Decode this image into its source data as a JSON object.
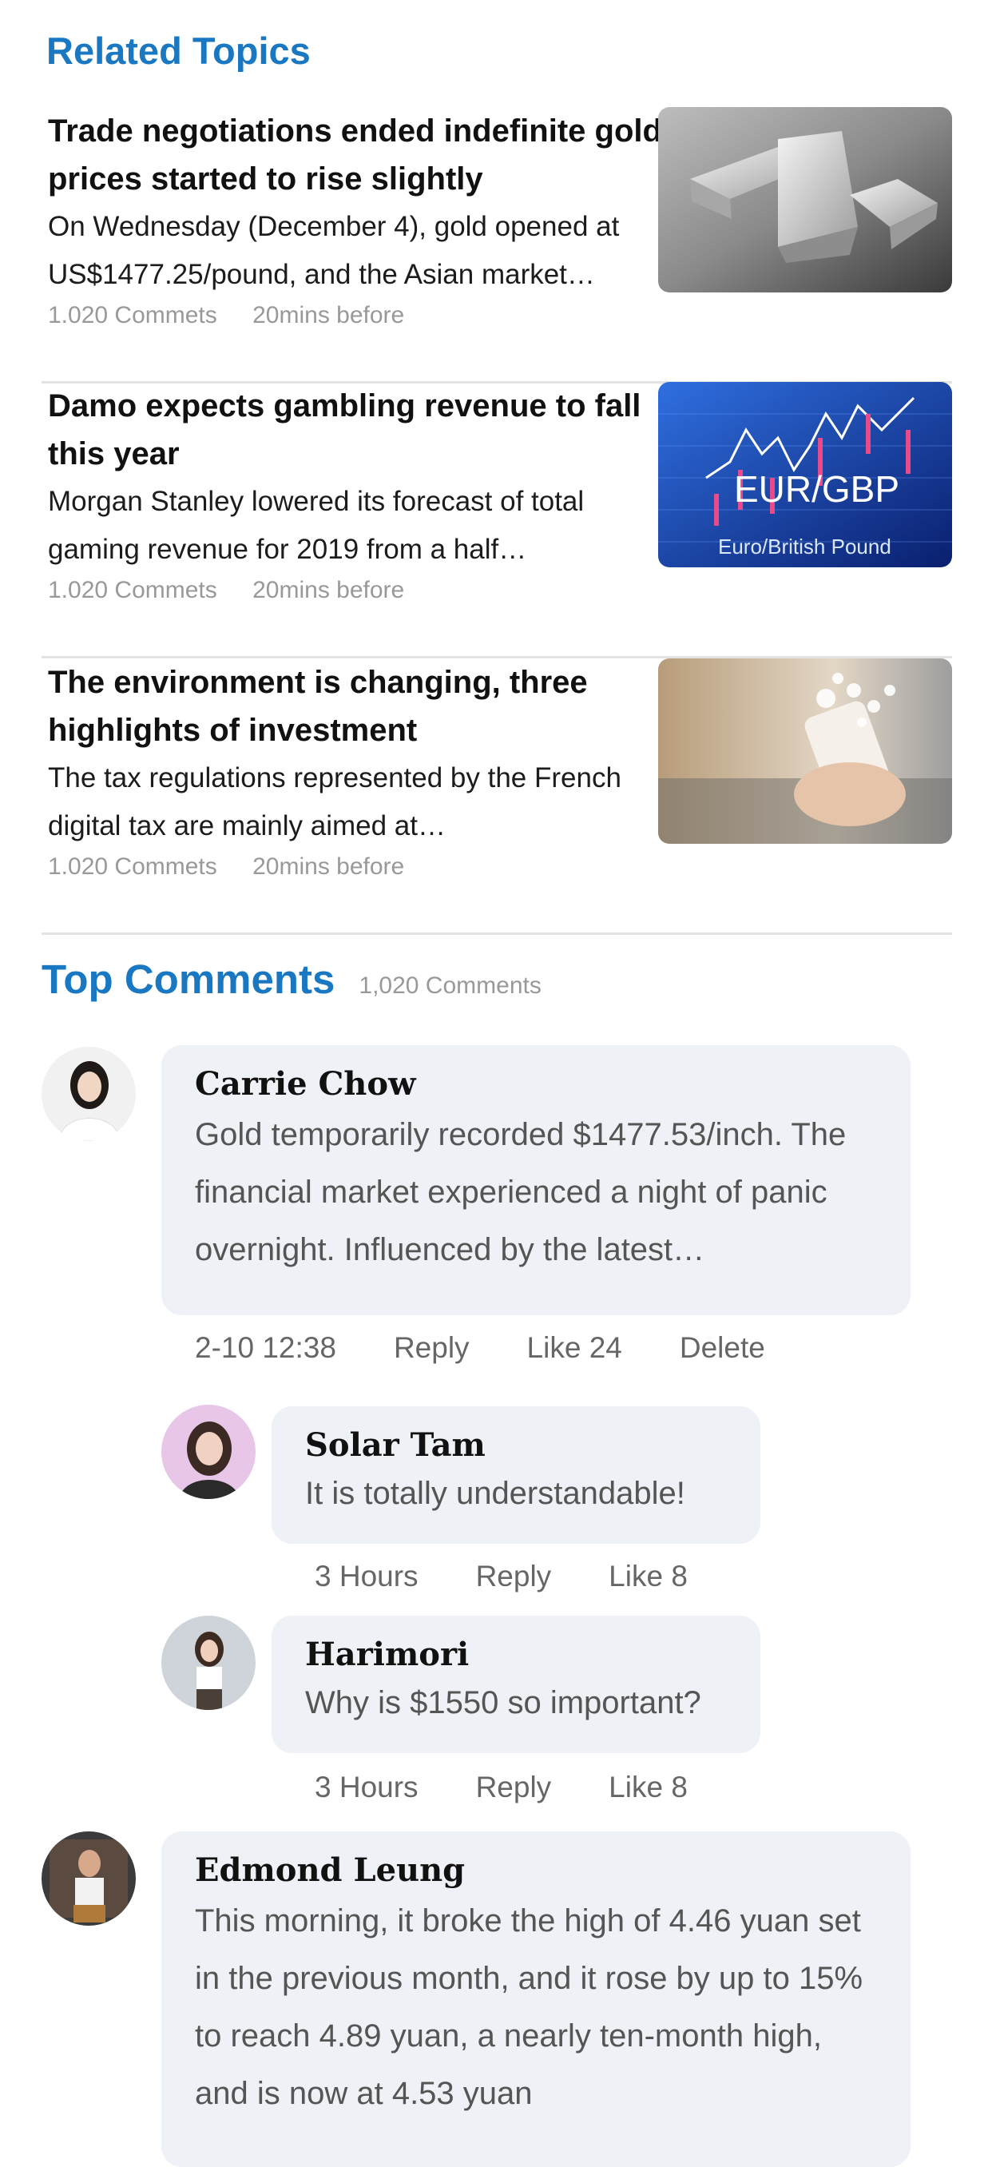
{
  "related": {
    "title": "Related Topics",
    "articles": [
      {
        "headline": "Trade negotiations ended indefinite gold prices started to rise slightly",
        "summary": "On Wednesday (December 4), gold opened at US$1477.25/pound, and the Asian market…",
        "comments": "1.020 Commets",
        "time": "20mins before",
        "image_icon": "gold-bars-image"
      },
      {
        "headline": "Damo expects gambling revenue to fall this year",
        "summary": "Morgan Stanley lowered its forecast of total gaming revenue for 2019 from a half…",
        "comments": "1.020 Commets",
        "time": "20mins before",
        "image_icon": "eur-gbp-chart-image",
        "image_label": "EUR/GBP",
        "image_sublabel": "Euro/British Pound"
      },
      {
        "headline": "The environment is changing, three highlights of investment",
        "summary": "The tax regulations represented by the French digital tax are mainly aimed at…",
        "comments": "1.020 Commets",
        "time": "20mins before",
        "image_icon": "phone-money-image"
      }
    ]
  },
  "comments": {
    "title": "Top Comments",
    "count": "1,020 Comments",
    "items": [
      {
        "name": "Carrie Chow",
        "body": "Gold temporarily recorded $1477.53/inch. The financial market experienced a night of panic overnight. Influenced by the latest…",
        "time": "2-10 12:38",
        "reply": "Reply",
        "like": "Like 24",
        "delete": "Delete"
      },
      {
        "name": "Solar Tam",
        "body": "It is totally understandable!",
        "time": "3 Hours",
        "reply": "Reply",
        "like": "Like 8"
      },
      {
        "name": "Harimori",
        "body": "Why is $1550 so important?",
        "time": "3 Hours",
        "reply": "Reply",
        "like": "Like 8"
      },
      {
        "name": "Edmond Leung",
        "body": "This morning, it broke the high of 4.46 yuan set in the previous month, and it rose by up to 15% to reach 4.89 yuan, a nearly ten-month high, and is now at 4.53 yuan"
      }
    ]
  },
  "colors": {
    "accent": "#1a78c2",
    "bubble": "#eef1f5",
    "meta": "#999999"
  }
}
